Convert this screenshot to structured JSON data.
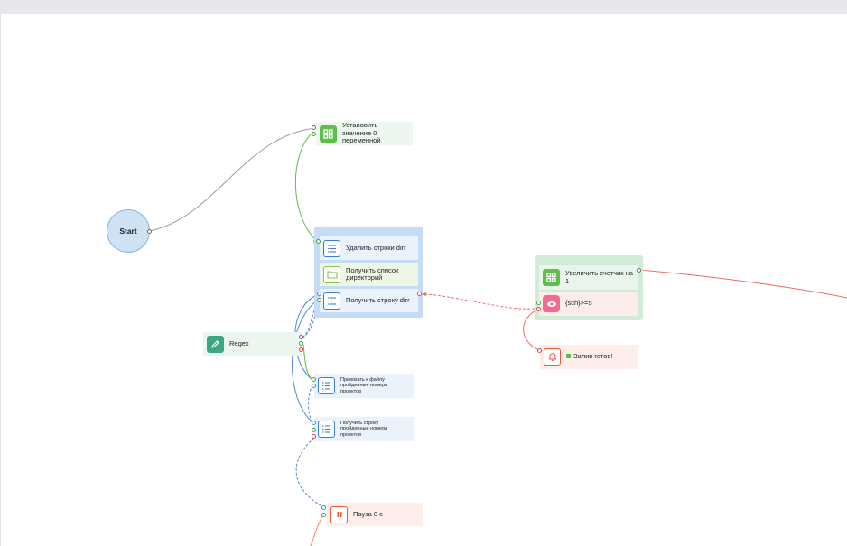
{
  "nodes": {
    "start": {
      "label": "Start"
    },
    "set_value": {
      "label": "Установить значение 0 переменной",
      "color": "#5fbf4a"
    },
    "delete_rows": {
      "label": "Удалить строки dirr"
    },
    "get_dirs": {
      "label": "Получить список директорий"
    },
    "get_row": {
      "label": "Получить строку dirr"
    },
    "regex": {
      "label": "Regex",
      "color": "#3ba882"
    },
    "bind_file": {
      "label": "Привязать к файлу пройденные номера проектов"
    },
    "get_row_projects": {
      "label": "Получить строку пройденные номера проектов"
    },
    "pause": {
      "label": "Пауза 0 с",
      "color": "#e85a3c"
    },
    "increment": {
      "label": "Увеличить счетчик на 1"
    },
    "condition": {
      "label": "{sch}>=5",
      "color": "#f06a91"
    },
    "done": {
      "label": "Залив готов!"
    }
  },
  "icons": {
    "grid": "grid-icon",
    "list": "list-icon",
    "folder": "folder-icon",
    "pencil": "pencil-icon",
    "eye": "eye-icon",
    "pause": "pause-icon",
    "bell": "bell-icon"
  },
  "colors": {
    "group_blue": "#c6dcf6",
    "group_green": "#d1ecd6",
    "link_green": "#5cbd4a",
    "link_red": "#ef6a6a",
    "link_blue": "#4a88d6",
    "link_gray": "#9a9a9a"
  }
}
